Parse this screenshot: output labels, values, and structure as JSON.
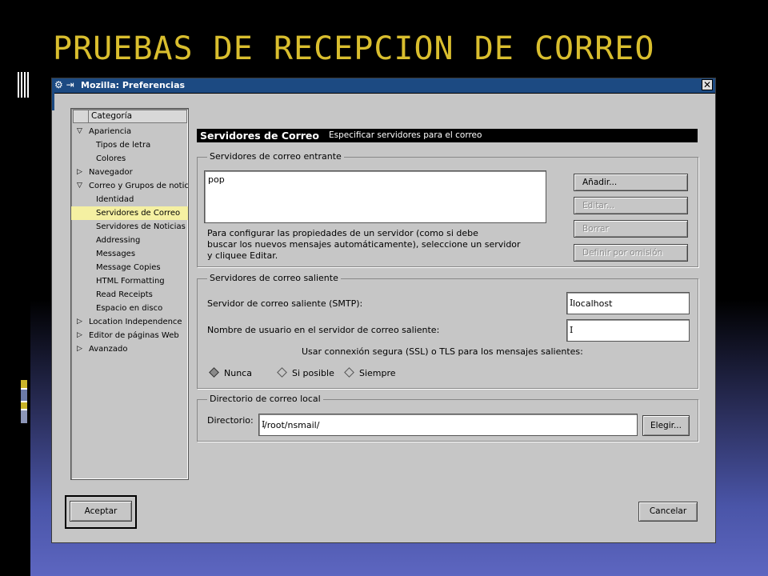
{
  "slide": {
    "title": "PRUEBAS DE RECEPCION DE CORREO"
  },
  "window": {
    "title": "Mozilla: Preferencias",
    "close_glyph": "✕"
  },
  "tree": {
    "header": "Categoría",
    "items": [
      {
        "label": "Apariencia",
        "arrow": "expanded",
        "level": 0
      },
      {
        "label": "Tipos de letra",
        "level": 1
      },
      {
        "label": "Colores",
        "level": 1
      },
      {
        "label": "Navegador",
        "arrow": "collapsed",
        "level": 0
      },
      {
        "label": "Correo y Grupos de notici",
        "arrow": "expanded",
        "level": 0
      },
      {
        "label": "Identidad",
        "level": 1
      },
      {
        "label": "Servidores de Correo",
        "level": 1,
        "selected": true
      },
      {
        "label": "Servidores de Noticias",
        "level": 1
      },
      {
        "label": "Addressing",
        "level": 1
      },
      {
        "label": "Messages",
        "level": 1
      },
      {
        "label": "Message Copies",
        "level": 1
      },
      {
        "label": "HTML Formatting",
        "level": 1
      },
      {
        "label": "Read Receipts",
        "level": 1
      },
      {
        "label": "Espacio en disco",
        "level": 1
      },
      {
        "label": "Location Independence",
        "arrow": "collapsed",
        "level": 0
      },
      {
        "label": "Editor de páginas Web",
        "arrow": "collapsed",
        "level": 0
      },
      {
        "label": "Avanzado",
        "arrow": "collapsed",
        "level": 0
      }
    ]
  },
  "panel": {
    "title": "Servidores de Correo",
    "subtitle": "Especificar servidores para el correo",
    "incoming": {
      "legend": "Servidores de correo entrante",
      "servers": [
        "pop"
      ],
      "help_lines": [
        "Para configurar las propiedades de un servidor (como si debe",
        "buscar los nuevos mensajes automáticamente), seleccione un servidor",
        "y cliquee Editar."
      ],
      "buttons": {
        "add": "Añadir...",
        "edit": "Editar...",
        "delete": "Borrar",
        "default": "Definir por omisión"
      }
    },
    "outgoing": {
      "legend": "Servidores de correo saliente",
      "smtp_label": "Servidor de correo saliente (SMTP):",
      "smtp_value": "localhost",
      "user_label": "Nombre de usuario en el servidor de correo saliente:",
      "user_value": "",
      "ssl_label": "Usar connexión segura (SSL) o TLS para los mensajes salientes:",
      "options": [
        "Nunca",
        "Si posible",
        "Siempre"
      ],
      "selected_option": "Nunca"
    },
    "local": {
      "legend": "Directorio de correo local",
      "dir_label": "Directorio:",
      "dir_value": "/root/nsmail/",
      "choose_button": "Elegir..."
    }
  },
  "footer": {
    "ok": "Aceptar",
    "cancel": "Cancelar"
  }
}
